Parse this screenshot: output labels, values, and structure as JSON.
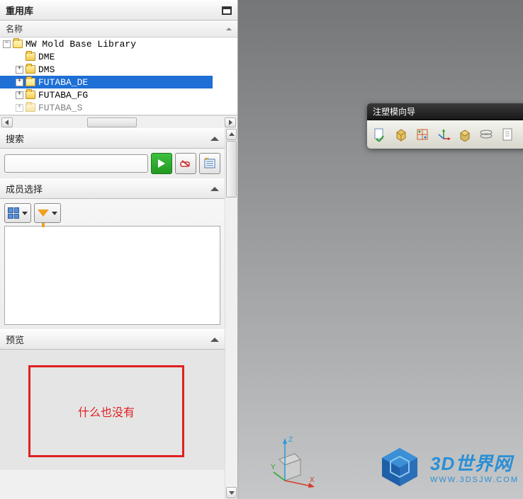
{
  "panel": {
    "title": "重用库",
    "nameHeader": "名称",
    "tree": {
      "root": "MW Mold Base Library",
      "items": [
        {
          "label": "DME",
          "expandable": false
        },
        {
          "label": "DMS",
          "expandable": true
        },
        {
          "label": "FUTABA_DE",
          "expandable": true,
          "selected": true
        },
        {
          "label": "FUTABA_FG",
          "expandable": true
        },
        {
          "label": "FUTABA_S",
          "expandable": true
        }
      ]
    }
  },
  "search": {
    "title": "搜索",
    "value": "",
    "placeholder": ""
  },
  "member": {
    "title": "成员选择"
  },
  "preview": {
    "title": "预览",
    "emptyText": "什么也没有"
  },
  "toolbar": {
    "title": "注塑模向导",
    "icons": [
      "doc-check-icon",
      "box-icon",
      "grid-axis-icon",
      "axis-xyz-icon",
      "cube-icon",
      "layers-icon",
      "page-icon"
    ]
  },
  "watermark": {
    "big": "3D世界网",
    "small": "WWW.3DSJW.COM"
  }
}
